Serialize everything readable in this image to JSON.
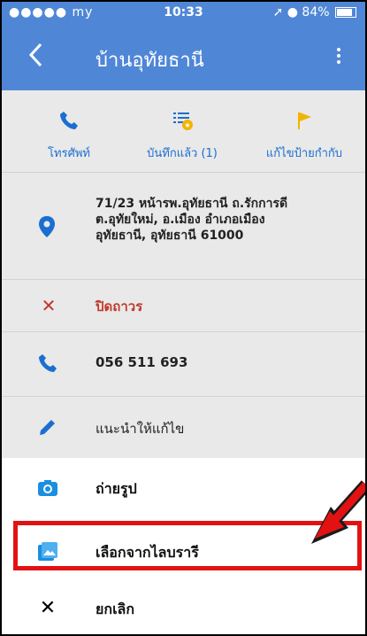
{
  "status_bar": {
    "carrier": "●●●●● my",
    "wifi": "wifi-icon",
    "time": "10:33",
    "battery_text": "84%"
  },
  "app_bar": {
    "title": "บ้านอุทัยธานี"
  },
  "actions": [
    {
      "icon": "phone-icon",
      "label": "โทรศัพท์"
    },
    {
      "icon": "saved-list-icon",
      "label": "บันทึกแล้ว (1)"
    },
    {
      "icon": "flag-icon",
      "label": "แก้ไขป้ายกำกับ"
    }
  ],
  "info": {
    "address": "71/23 หน้ารพ.อุทัยธานี ถ.รักการดี\nต.อุทัยใหม่, อ.เมือง อำเภอเมือง\nอุทัยธานี, อุทัยธานี 61000",
    "status": "ปิดถาวร",
    "phone": "056 511 693",
    "suggest_edit": "แนะนำให้แก้ไข"
  },
  "sheet": {
    "take_photo": "ถ่ายรูป",
    "choose_library": "เลือกจากไลบรารี",
    "cancel": "ยกเลิก"
  },
  "colors": {
    "brand": "#4f87d6",
    "highlight": "#e31212",
    "link": "#1a6fd0",
    "flag": "#f2b400"
  }
}
